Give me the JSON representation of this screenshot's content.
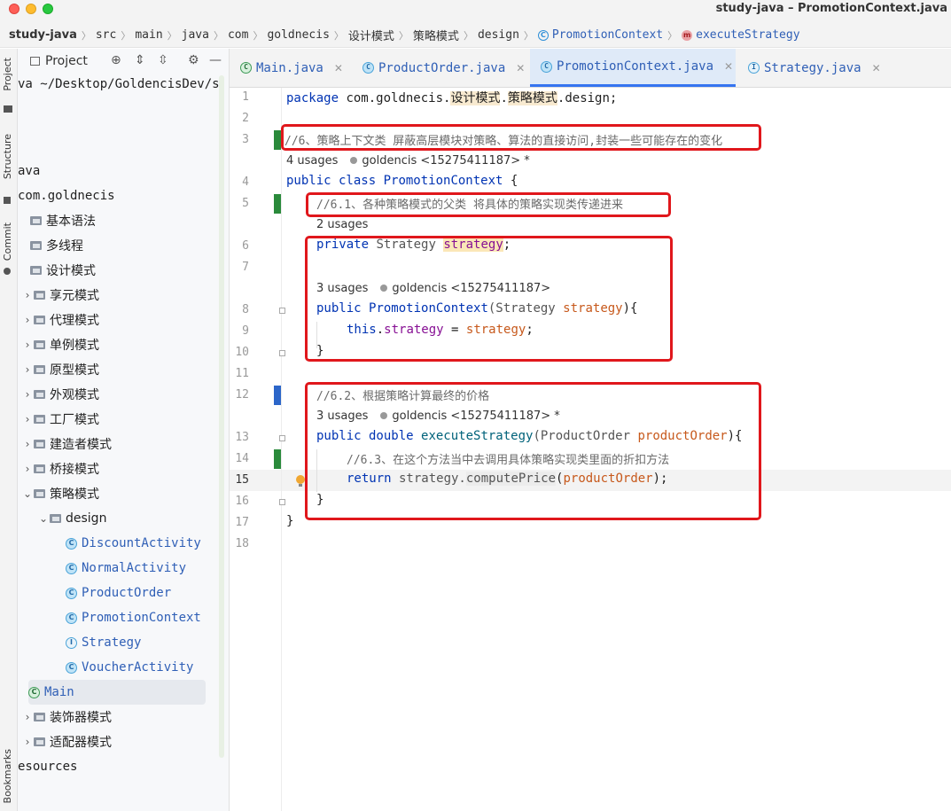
{
  "window": {
    "title": "study-java – PromotionContext.java"
  },
  "breadcrumb": {
    "items": [
      "study-java",
      "src",
      "main",
      "java",
      "com",
      "goldnecis",
      "设计模式",
      "策略模式",
      "design"
    ],
    "class_name": "PromotionContext",
    "method_name": "executeStrategy"
  },
  "sidebar_tools": {
    "project": "Project",
    "structure": "Structure",
    "commit": "Commit",
    "bookmarks": "Bookmarks"
  },
  "project_panel": {
    "title": "Project",
    "root_path": "va  ~/Desktop/GoldencisDev/s",
    "tree": [
      {
        "label": "ava",
        "indent": 0,
        "kind": "text"
      },
      {
        "label": "com.goldnecis",
        "indent": 0,
        "kind": "text"
      },
      {
        "label": "基本语法",
        "indent": 0,
        "kind": "folder",
        "chev": ""
      },
      {
        "label": "多线程",
        "indent": 0,
        "kind": "folder",
        "chev": ""
      },
      {
        "label": "设计模式",
        "indent": 0,
        "kind": "folder",
        "chev": ""
      },
      {
        "label": "享元模式",
        "indent": 1,
        "kind": "folder",
        "chev": "›"
      },
      {
        "label": "代理模式",
        "indent": 1,
        "kind": "folder",
        "chev": "›"
      },
      {
        "label": "单例模式",
        "indent": 1,
        "kind": "folder",
        "chev": "›"
      },
      {
        "label": "原型模式",
        "indent": 1,
        "kind": "folder",
        "chev": "›"
      },
      {
        "label": "外观模式",
        "indent": 1,
        "kind": "folder",
        "chev": "›"
      },
      {
        "label": "工厂模式",
        "indent": 1,
        "kind": "folder",
        "chev": "›"
      },
      {
        "label": "建造者模式",
        "indent": 1,
        "kind": "folder",
        "chev": "›"
      },
      {
        "label": "桥接模式",
        "indent": 1,
        "kind": "folder",
        "chev": "›"
      },
      {
        "label": "策略模式",
        "indent": 1,
        "kind": "folder",
        "chev": "⌄"
      },
      {
        "label": "design",
        "indent": 2,
        "kind": "folder",
        "chev": "⌄"
      },
      {
        "label": "DiscountActivity",
        "indent": 3,
        "kind": "class"
      },
      {
        "label": "NormalActivity",
        "indent": 3,
        "kind": "class"
      },
      {
        "label": "ProductOrder",
        "indent": 3,
        "kind": "class"
      },
      {
        "label": "PromotionContext",
        "indent": 3,
        "kind": "class"
      },
      {
        "label": "Strategy",
        "indent": 3,
        "kind": "class"
      },
      {
        "label": "VoucherActivity",
        "indent": 3,
        "kind": "class"
      },
      {
        "label": "Main",
        "indent": 2,
        "kind": "class",
        "selected": true
      },
      {
        "label": "装饰器模式",
        "indent": 1,
        "kind": "folder",
        "chev": "›"
      },
      {
        "label": "适配器模式",
        "indent": 1,
        "kind": "folder",
        "chev": "›"
      },
      {
        "label": "esources",
        "indent": 0,
        "kind": "text"
      }
    ]
  },
  "tabs": [
    {
      "label": "Main.java",
      "active": false
    },
    {
      "label": "ProductOrder.java",
      "active": false
    },
    {
      "label": "PromotionContext.java",
      "active": true
    },
    {
      "label": "Strategy.java",
      "active": false
    }
  ],
  "editor": {
    "current_line": "15",
    "line_numbers": [
      "1",
      "2",
      "3",
      "4",
      "5",
      "6",
      "7",
      "8",
      "9",
      "10",
      "11",
      "12",
      "13",
      "14",
      "15",
      "16",
      "17",
      "18"
    ],
    "code": {
      "l1_kw": "package",
      "l1_a": "com.goldnecis.",
      "l1_b": "设计模式",
      "l1_c": ".",
      "l1_d": "策略模式",
      "l1_e": ".design;",
      "l3": "//6、策略上下文类 屏蔽高层模块对策略、算法的直接访问,封装一些可能存在的变化",
      "hint3_usages": "4 usages",
      "hint3_author": "goldencis <15275411187> *",
      "l4_kw": "public class",
      "l4_name": "PromotionContext",
      "l4_end": " {",
      "l5": "//6.1、各种策略模式的父类 将具体的策略实现类传递进来",
      "hint6_usages": "2 usages",
      "l6_kw": "private",
      "l6_type": " Strategy ",
      "l6_field": "strategy",
      "l6_end": ";",
      "hint8_usages": "3 usages",
      "hint8_author": "goldencis <15275411187>",
      "l8_kw": "public",
      "l8_name": "PromotionContext",
      "l8_a": "(Strategy ",
      "l8_param": "strategy",
      "l8_end": "){",
      "l9_kw": "this",
      "l9_a": ".",
      "l9_field": "strategy",
      "l9_b": " = ",
      "l9_param": "strategy",
      "l9_end": ";",
      "l10": "}",
      "l12": "//6.2、根据策略计算最终的价格",
      "hint13_usages": "3 usages",
      "hint13_author": "goldencis <15275411187> *",
      "l13_kw": "public double",
      "l13_name": "executeStrategy",
      "l13_a": "(ProductOrder ",
      "l13_param": "productOrder",
      "l13_end": "){",
      "l14": "//6.3、在这个方法当中去调用具体策略实现类里面的折扣方法",
      "l15_kw": "return",
      "l15_a": " strategy.",
      "l15_fn": "computePrice",
      "l15_b": "(",
      "l15_param": "productOrder",
      "l15_end": ");",
      "l16": "}",
      "l17": "}"
    }
  },
  "colors": {
    "annotation_red": "#e0171c",
    "vcs_added_green": "#2a8a3b",
    "vcs_modified_blue": "#2c66c9",
    "active_tab_underline": "#3574f0"
  }
}
